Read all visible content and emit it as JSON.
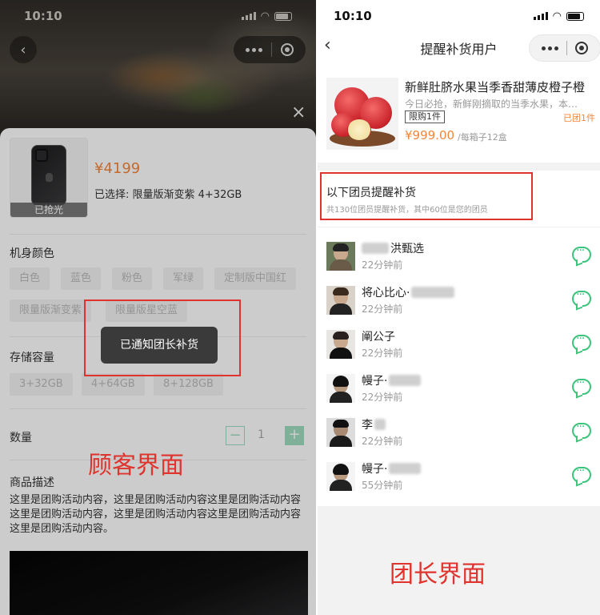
{
  "customer_screen": {
    "status_time": "10:10",
    "sheet_close": "×",
    "product": {
      "thumb_overlay": "已抢光",
      "price": "¥4199",
      "selected": "已选择:  限量版渐变紫   4+32GB"
    },
    "color_section": {
      "label": "机身颜色",
      "options": [
        "白色",
        "蓝色",
        "粉色",
        "军绿",
        "定制版中国红",
        "限量版渐变紫",
        "限量版星空蓝"
      ]
    },
    "storage_section": {
      "label": "存储容量",
      "options": [
        "3+32GB",
        "4+64GB",
        "8+128GB"
      ]
    },
    "quantity": {
      "label": "数量",
      "value": "1",
      "minus": "−",
      "plus": "+"
    },
    "description": {
      "label": "商品描述",
      "text": "这里是团购活动内容，这里是团购活动内容这里是团购活动内容这里是团购活动内容，这里是团购活动内容这里是团购活动内容这里是团购活动内容。"
    },
    "toast": "已通知团长补货",
    "caption": "顾客界面"
  },
  "leader_screen": {
    "status_time": "10:10",
    "nav_title": "提醒补货用户",
    "back": "‹",
    "product": {
      "title": "新鲜肚脐水果当季香甜薄皮橙子橙",
      "subtitle": "今日必抢，新鲜刚摘取的当季水果，本…",
      "limit_badge": "限购1件",
      "joined": "已团1件",
      "price": "¥999.00",
      "unit": "/每箱子12盒"
    },
    "members_section": {
      "title": "以下团员提醒补货",
      "subtitle": "共130位团员提醒补货，其中60位是您的团员"
    },
    "members": [
      {
        "name_visible": "洪甄选",
        "time": "22分钟前"
      },
      {
        "name_visible": "将心比心·",
        "time": "22分钟前"
      },
      {
        "name_visible": "阐公子",
        "time": "22分钟前"
      },
      {
        "name_visible": "幔子·",
        "time": "22分钟前"
      },
      {
        "name_visible": "李",
        "time": "22分钟前"
      },
      {
        "name_visible": "幔子·",
        "time": "55分钟前"
      }
    ],
    "caption": "团长界面"
  },
  "icons": {
    "back": "chevron-left-icon",
    "more": "more-dots-icon",
    "target": "capsule-target-icon",
    "chat": "chat-bubble-icon"
  },
  "colors": {
    "price_orange": "#f4863a",
    "annotation_red": "#e0332d",
    "chat_green": "#3cc47c",
    "stepper_green": "#9fdcc1"
  }
}
